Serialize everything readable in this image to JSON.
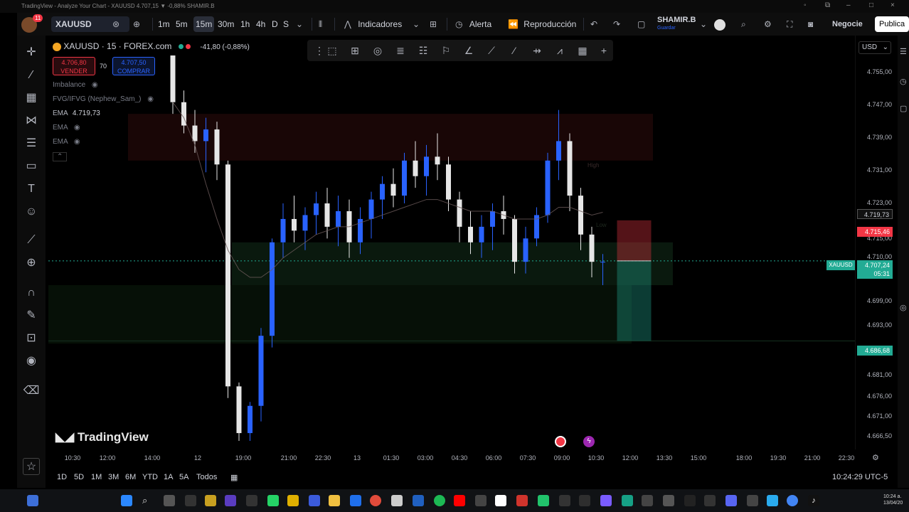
{
  "titlebar": {
    "text": "TradingView - Analyze Your Chart - XAUUSD 4.707,15 ▼ -0,88% SHAMIR.B"
  },
  "toolbar": {
    "avatar_badge": "11",
    "symbol": "XAUUSD",
    "intervals": [
      "1m",
      "5m",
      "15m",
      "30m",
      "1h",
      "4h",
      "D",
      "S"
    ],
    "selected_interval": "15m",
    "indicators_label": "Indicadores",
    "alert_label": "Alerta",
    "replay_label": "Reproducción",
    "user_name": "SHAMIR.B",
    "user_sub": "Guardar",
    "trade_label": "Negocie",
    "publish_label": "Publica"
  },
  "legend": {
    "symbol_line": "XAUUSD · 15 · FOREX.com",
    "change": "-41,80 (-0,88%)",
    "sell_price": "4.706,80",
    "sell_label": "VENDER",
    "spread": "70",
    "buy_price": "4.707,50",
    "buy_label": "COMPRAR",
    "indicators": [
      {
        "name": "Imbalance",
        "value": ""
      },
      {
        "name": "FVG/IFVG (Nephew_Sam_)",
        "value": ""
      },
      {
        "name": "EMA",
        "value": "4.719,73"
      },
      {
        "name": "EMA",
        "value": ""
      },
      {
        "name": "EMA",
        "value": ""
      }
    ],
    "zone_high": "High",
    "zone_low": "Low"
  },
  "currency": "USD",
  "price_scale": [
    "4.755,00",
    "4.747,00",
    "4.739,00",
    "4.731,00",
    "4.723,00",
    "4.715,00",
    "4.710,00",
    "4.699,00",
    "4.693,00",
    "4.686,00",
    "4.681,00",
    "4.676,00",
    "4.671,00",
    "4.666,50"
  ],
  "price_tags": {
    "ema": "4.719,73",
    "stop": "4.715,46",
    "symbol_tag": "XAUUSD",
    "current": "4.707,24",
    "countdown": "05:31",
    "target": "4.686,68"
  },
  "time_labels": [
    "10:30",
    "12:00",
    "14:00",
    "12",
    "19:00",
    "21:00",
    "22:30",
    "13",
    "01:30",
    "03:00",
    "04:30",
    "06:00",
    "07:30",
    "09:00",
    "10:30",
    "12:00",
    "13:30",
    "15:00",
    "18:00",
    "19:30",
    "21:00",
    "22:30"
  ],
  "ranges": [
    "1D",
    "5D",
    "1M",
    "3M",
    "6M",
    "YTD",
    "1A",
    "5A",
    "Todos"
  ],
  "clock": "10:24:29 UTC-5",
  "watermark": "TradingView",
  "tray": {
    "time": "10:24 a.",
    "date": "13/04/20"
  },
  "colors": {
    "up": "#2962ff",
    "down": "#e6e6e6",
    "sell": "#f23645",
    "buy": "#2962ff",
    "target": "#22ab94",
    "background": "#000000"
  },
  "chart_data": {
    "type": "candlestick",
    "symbol": "XAUUSD",
    "timeframe": "15",
    "ylim": [
      4661,
      4760
    ],
    "candles_ohlc": [
      [
        4760,
        4760,
        4745,
        4748
      ],
      [
        4748,
        4751,
        4740,
        4742
      ],
      [
        4742,
        4746,
        4735,
        4738
      ],
      [
        4738,
        4744,
        4730,
        4741
      ],
      [
        4741,
        4743,
        4728,
        4732
      ],
      [
        4732,
        4733,
        4672,
        4675
      ],
      [
        4675,
        4676,
        4661,
        4663
      ],
      [
        4663,
        4671,
        4661,
        4670
      ],
      [
        4670,
        4690,
        4666,
        4688
      ],
      [
        4688,
        4713,
        4685,
        4712
      ],
      [
        4712,
        4722,
        4708,
        4718
      ],
      [
        4718,
        4724,
        4712,
        4715
      ],
      [
        4715,
        4721,
        4710,
        4719
      ],
      [
        4719,
        4725,
        4714,
        4722
      ],
      [
        4722,
        4726,
        4713,
        4716
      ],
      [
        4716,
        4724,
        4711,
        4720
      ],
      [
        4720,
        4723,
        4708,
        4712
      ],
      [
        4712,
        4721,
        4709,
        4718
      ],
      [
        4718,
        4725,
        4713,
        4723
      ],
      [
        4723,
        4729,
        4718,
        4727
      ],
      [
        4727,
        4731,
        4721,
        4724
      ],
      [
        4724,
        4735,
        4722,
        4733
      ],
      [
        4733,
        4738,
        4726,
        4729
      ],
      [
        4729,
        4737,
        4724,
        4734
      ],
      [
        4734,
        4740,
        4728,
        4732
      ],
      [
        4732,
        4734,
        4720,
        4723
      ],
      [
        4723,
        4725,
        4712,
        4716
      ],
      [
        4716,
        4720,
        4709,
        4712
      ],
      [
        4712,
        4719,
        4708,
        4716
      ],
      [
        4716,
        4722,
        4710,
        4720
      ],
      [
        4720,
        4724,
        4714,
        4718
      ],
      [
        4718,
        4719,
        4704,
        4707
      ],
      [
        4707,
        4716,
        4704,
        4713
      ],
      [
        4713,
        4721,
        4711,
        4719
      ],
      [
        4719,
        4735,
        4717,
        4733
      ],
      [
        4733,
        4746,
        4728,
        4738
      ],
      [
        4738,
        4740,
        4720,
        4724
      ],
      [
        4724,
        4726,
        4710,
        4714
      ],
      [
        4714,
        4716,
        4703,
        4707
      ],
      [
        4707,
        4709,
        4701,
        4707
      ]
    ],
    "ema": [
      4748,
      4744,
      4737,
      4727,
      4718,
      4710,
      4705,
      4703,
      4703,
      4705,
      4708,
      4710,
      4712,
      4714,
      4715,
      4716,
      4716,
      4717,
      4718,
      4719,
      4720,
      4721,
      4722,
      4723,
      4723,
      4722,
      4721,
      4720,
      4720,
      4720,
      4719,
      4718,
      4718,
      4718,
      4719,
      4721,
      4721,
      4720,
      4719,
      4719.73
    ],
    "position": {
      "entry": 4707.24,
      "stop": 4715.46,
      "target": 4686.68
    }
  }
}
